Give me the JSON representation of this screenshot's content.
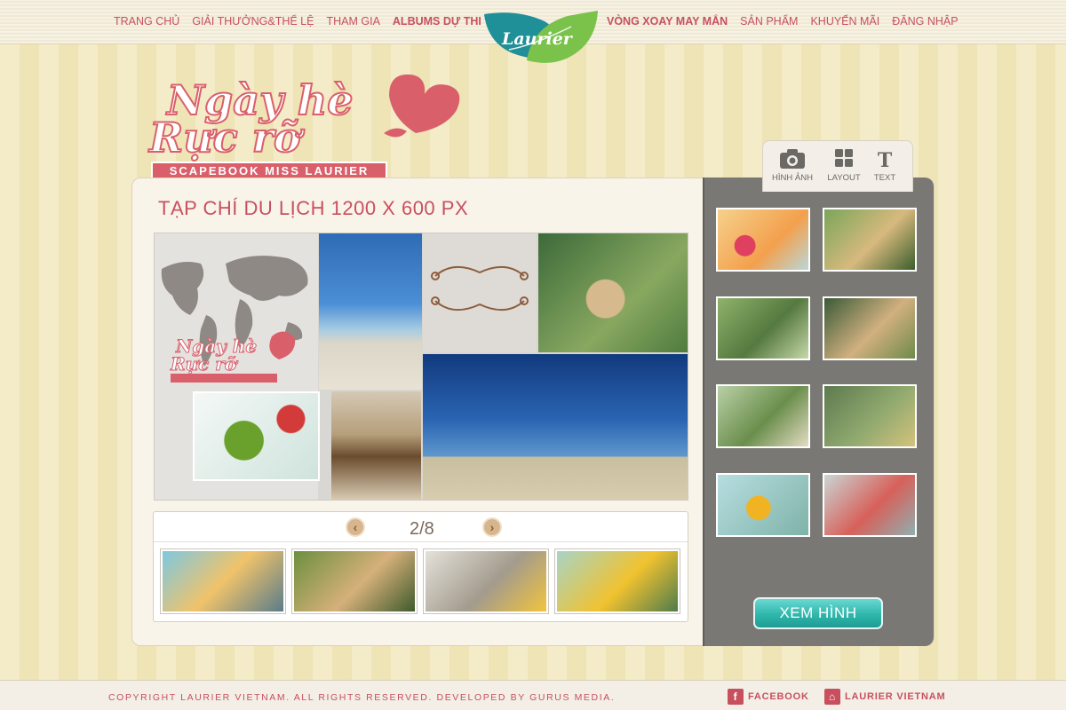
{
  "nav": {
    "left": [
      "TRANG CHỦ",
      "GIẢI THƯỞNG&THỂ LỆ",
      "THAM GIA",
      "ALBUMS DỰ THI"
    ],
    "right": [
      "VÒNG XOAY MAY MẮN",
      "SẢN PHẨM",
      "KHUYẾN MÃI",
      "ĐĂNG NHẬP"
    ],
    "logo": "Laurier"
  },
  "title_graphic": {
    "line1": "Ngày hè",
    "line2": "Rực rỡ",
    "ribbon": "SCAPEBOOK MISS LAURIER"
  },
  "main": {
    "title": "TẠP CHÍ DU LỊCH  1200 X 600 PX"
  },
  "pager": {
    "count": "2/8",
    "prev_icon": "chevron-left-icon",
    "next_icon": "chevron-right-icon"
  },
  "side": {
    "tabs": [
      {
        "label": "HÌNH ẢNH",
        "icon": "camera-icon"
      },
      {
        "label": "LAYOUT",
        "icon": "grid-icon"
      },
      {
        "label": "TEXT",
        "icon": "text-icon"
      }
    ],
    "button": "XEM HÌNH"
  },
  "footer": {
    "copyright": "COPYRIGHT LAURIER VIETNAM. ALL RIGHTS RESERVED. DEVELOPED BY GURUS MEDIA.",
    "facebook": "FACEBOOK",
    "laurier": "LAURIER VIETNAM"
  },
  "colors": {
    "accent": "#c8505e",
    "button": "#2fb7ad",
    "sidebar": "#7a7874"
  }
}
